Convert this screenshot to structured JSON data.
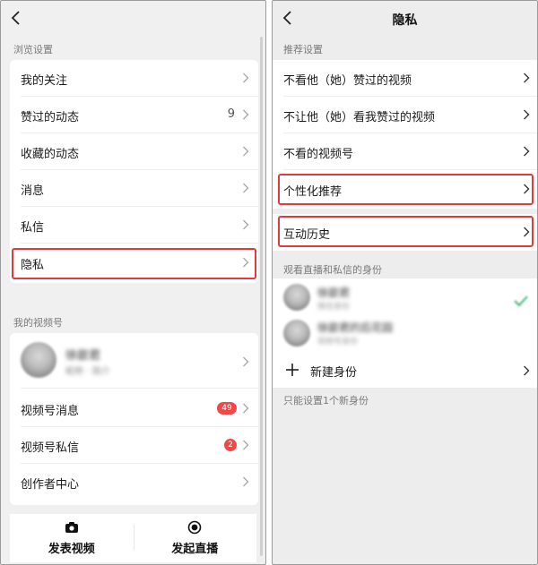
{
  "left": {
    "section_browse": "浏览设置",
    "browse_items": [
      {
        "label": "我的关注"
      },
      {
        "label": "赞过的动态",
        "count": "9"
      },
      {
        "label": "收藏的动态"
      },
      {
        "label": "消息"
      },
      {
        "label": "私信"
      },
      {
        "label": "隐私"
      }
    ],
    "section_channel": "我的视频号",
    "channel_profile": {
      "name": "徐歆君",
      "sub": "昵称 · 简介"
    },
    "channel_items": [
      {
        "label": "视频号消息",
        "badge": "49"
      },
      {
        "label": "视频号私信",
        "badge": "2"
      },
      {
        "label": "创作者中心"
      }
    ],
    "bottom": {
      "post_video": "发表视频",
      "start_live": "发起直播"
    }
  },
  "right": {
    "title": "隐私",
    "section_recommend": "推荐设置",
    "recommend_items": [
      {
        "label": "不看他（她）赞过的视频"
      },
      {
        "label": "不让他（她）看我赞过的视频"
      },
      {
        "label": "不看的视频号"
      },
      {
        "label": "个性化推荐"
      }
    ],
    "history_item": "互动历史",
    "section_identity": "观看直播和私信的身份",
    "identities": [
      {
        "name": "徐歆君",
        "sub": "微信身份"
      },
      {
        "name": "徐歆君的后花园",
        "sub": "视频号身份"
      }
    ],
    "new_identity": "新建身份",
    "hint": "只能设置1个新身份"
  },
  "colors": {
    "highlight": "#e23a3a",
    "badge": "#f04848",
    "check": "#3cb371"
  }
}
